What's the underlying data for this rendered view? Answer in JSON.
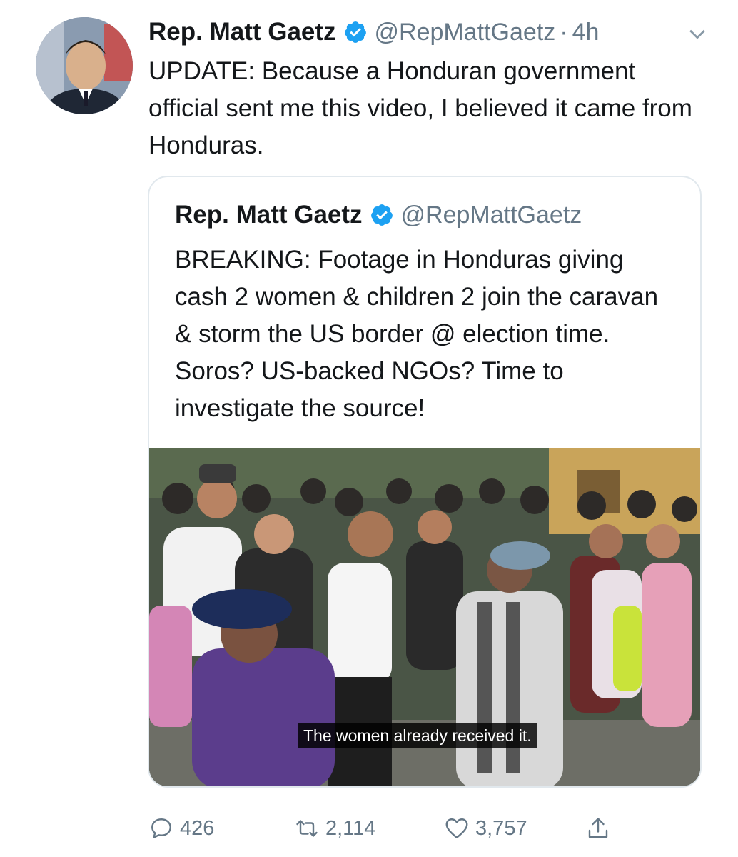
{
  "tweet": {
    "author_name": "Rep. Matt Gaetz",
    "handle": "@RepMattGaetz",
    "separator": "·",
    "time": "4h",
    "text": "UPDATE: Because a Honduran government official sent me this video, I believed it came from Honduras."
  },
  "quoted_tweet": {
    "author_name": "Rep. Matt Gaetz",
    "handle": "@RepMattGaetz",
    "text": "BREAKING: Footage in Honduras giving cash 2 women & children 2 join the caravan & storm the US border @ election time. Soros? US-backed NGOs? Time to investigate the source!",
    "video_caption": "The women already received it."
  },
  "actions": {
    "replies": "426",
    "retweets": "2,114",
    "likes": "3,757"
  },
  "colors": {
    "text": "#14171a",
    "secondary": "#657786",
    "verified": "#1da1f2",
    "border": "#e1e8ed"
  },
  "icons": [
    "verified-badge-icon",
    "chevron-down-icon",
    "reply-icon",
    "retweet-icon",
    "like-icon",
    "share-icon"
  ]
}
